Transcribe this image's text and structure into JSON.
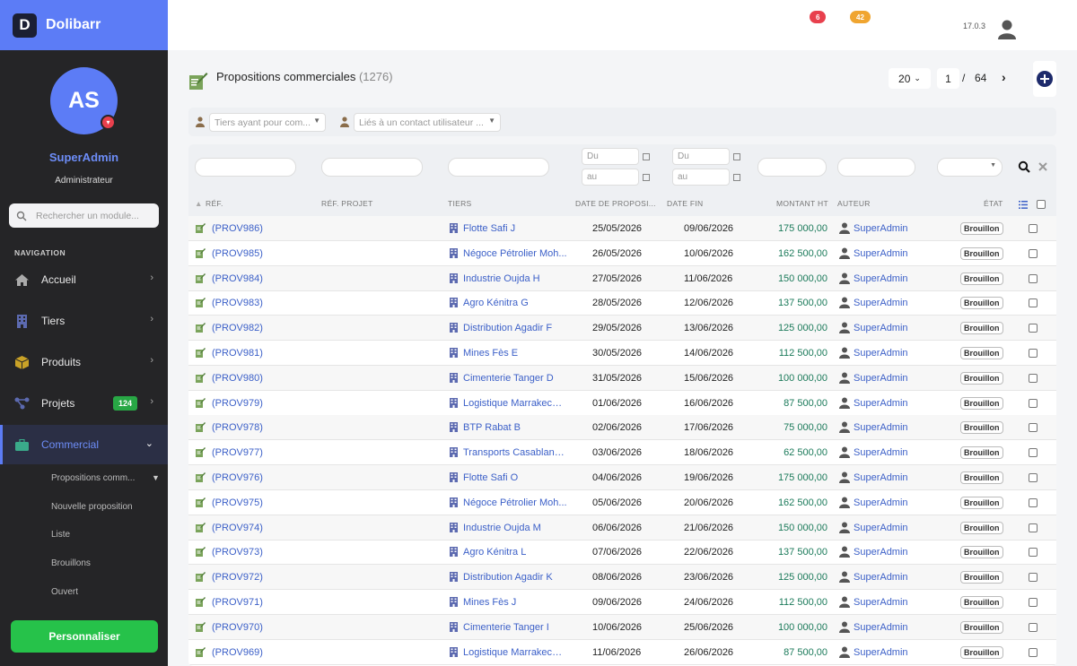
{
  "brand": {
    "name": "Dolibarr",
    "logo_letter": "D"
  },
  "user": {
    "initials": "AS",
    "name": "SuperAdmin",
    "role": "Administrateur"
  },
  "module_search": {
    "placeholder": "Rechercher un module..."
  },
  "nav": {
    "title": "NAVIGATION",
    "items": [
      {
        "label": "Accueil",
        "icon": "home-icon"
      },
      {
        "label": "Tiers",
        "icon": "building-icon"
      },
      {
        "label": "Produits",
        "icon": "box-icon"
      },
      {
        "label": "Projets",
        "icon": "project-icon",
        "count": "124"
      },
      {
        "label": "Commercial",
        "icon": "briefcase-icon",
        "active": true
      }
    ],
    "sub_items": [
      "Propositions comm...",
      "Nouvelle proposition",
      "Liste",
      "Brouillons",
      "Ouvert"
    ]
  },
  "customize_label": "Personnaliser",
  "topbar": {
    "badge_red": "6",
    "badge_orange": "42",
    "version": "17.0.3",
    "colors": {
      "red": "#e8404d",
      "orange": "#f0a530"
    }
  },
  "page": {
    "title": "Propositions commerciales",
    "count": "(1276)"
  },
  "pager": {
    "size": "20",
    "page": "1",
    "separator": "/",
    "total": "64"
  },
  "filters": {
    "thirdparty_placeholder": "Tiers ayant pour com...",
    "contact_placeholder": "Liés à un contact utilisateur ..."
  },
  "search_row": {
    "from": "Du",
    "to": "au"
  },
  "columns": {
    "ref": "RÉF.",
    "project": "RÉF. PROJET",
    "thirdparty": "TIERS",
    "date": "DATE DE PROPOSI...",
    "end_date": "DATE FIN",
    "amount": "MONTANT HT",
    "author": "AUTEUR",
    "status": "ÉTAT"
  },
  "rows": [
    {
      "ref": "(PROV986)",
      "thirdparty": "Flotte Safi J",
      "date": "25/05/2026",
      "end": "09/06/2026",
      "amount": "175 000,00",
      "author": "SuperAdmin",
      "status": "Brouillon"
    },
    {
      "ref": "(PROV985)",
      "thirdparty": "Négoce Pétrolier Moh...",
      "date": "26/05/2026",
      "end": "10/06/2026",
      "amount": "162 500,00",
      "author": "SuperAdmin",
      "status": "Brouillon"
    },
    {
      "ref": "(PROV984)",
      "thirdparty": "Industrie Oujda H",
      "date": "27/05/2026",
      "end": "11/06/2026",
      "amount": "150 000,00",
      "author": "SuperAdmin",
      "status": "Brouillon"
    },
    {
      "ref": "(PROV983)",
      "thirdparty": "Agro Kénitra G",
      "date": "28/05/2026",
      "end": "12/06/2026",
      "amount": "137 500,00",
      "author": "SuperAdmin",
      "status": "Brouillon"
    },
    {
      "ref": "(PROV982)",
      "thirdparty": "Distribution Agadir F",
      "date": "29/05/2026",
      "end": "13/06/2026",
      "amount": "125 000,00",
      "author": "SuperAdmin",
      "status": "Brouillon"
    },
    {
      "ref": "(PROV981)",
      "thirdparty": "Mines Fès E",
      "date": "30/05/2026",
      "end": "14/06/2026",
      "amount": "112 500,00",
      "author": "SuperAdmin",
      "status": "Brouillon"
    },
    {
      "ref": "(PROV980)",
      "thirdparty": "Cimenterie Tanger D",
      "date": "31/05/2026",
      "end": "15/06/2026",
      "amount": "100 000,00",
      "author": "SuperAdmin",
      "status": "Brouillon"
    },
    {
      "ref": "(PROV979)",
      "thirdparty": "Logistique Marrakech C",
      "date": "01/06/2026",
      "end": "16/06/2026",
      "amount": "87 500,00",
      "author": "SuperAdmin",
      "status": "Brouillon"
    },
    {
      "ref": "(PROV978)",
      "thirdparty": "BTP Rabat B",
      "date": "02/06/2026",
      "end": "17/06/2026",
      "amount": "75 000,00",
      "author": "SuperAdmin",
      "status": "Brouillon"
    },
    {
      "ref": "(PROV977)",
      "thirdparty": "Transports Casablanc...",
      "date": "03/06/2026",
      "end": "18/06/2026",
      "amount": "62 500,00",
      "author": "SuperAdmin",
      "status": "Brouillon"
    },
    {
      "ref": "(PROV976)",
      "thirdparty": "Flotte Safi O",
      "date": "04/06/2026",
      "end": "19/06/2026",
      "amount": "175 000,00",
      "author": "SuperAdmin",
      "status": "Brouillon"
    },
    {
      "ref": "(PROV975)",
      "thirdparty": "Négoce Pétrolier Moh...",
      "date": "05/06/2026",
      "end": "20/06/2026",
      "amount": "162 500,00",
      "author": "SuperAdmin",
      "status": "Brouillon"
    },
    {
      "ref": "(PROV974)",
      "thirdparty": "Industrie Oujda M",
      "date": "06/06/2026",
      "end": "21/06/2026",
      "amount": "150 000,00",
      "author": "SuperAdmin",
      "status": "Brouillon"
    },
    {
      "ref": "(PROV973)",
      "thirdparty": "Agro Kénitra L",
      "date": "07/06/2026",
      "end": "22/06/2026",
      "amount": "137 500,00",
      "author": "SuperAdmin",
      "status": "Brouillon"
    },
    {
      "ref": "(PROV972)",
      "thirdparty": "Distribution Agadir K",
      "date": "08/06/2026",
      "end": "23/06/2026",
      "amount": "125 000,00",
      "author": "SuperAdmin",
      "status": "Brouillon"
    },
    {
      "ref": "(PROV971)",
      "thirdparty": "Mines Fès J",
      "date": "09/06/2026",
      "end": "24/06/2026",
      "amount": "112 500,00",
      "author": "SuperAdmin",
      "status": "Brouillon"
    },
    {
      "ref": "(PROV970)",
      "thirdparty": "Cimenterie Tanger I",
      "date": "10/06/2026",
      "end": "25/06/2026",
      "amount": "100 000,00",
      "author": "SuperAdmin",
      "status": "Brouillon"
    },
    {
      "ref": "(PROV969)",
      "thirdparty": "Logistique Marrakech H",
      "date": "11/06/2026",
      "end": "26/06/2026",
      "amount": "87 500,00",
      "author": "SuperAdmin",
      "status": "Brouillon"
    }
  ]
}
